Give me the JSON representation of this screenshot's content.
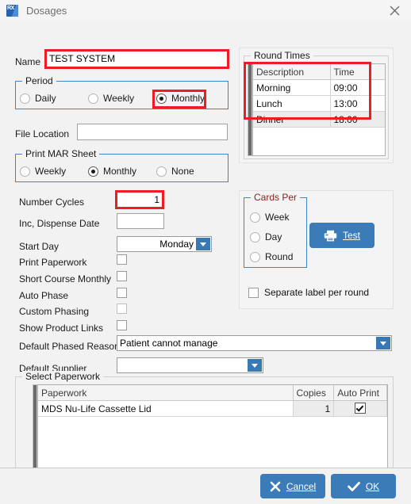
{
  "window": {
    "title": "Dosages",
    "icon": "rx-app-icon",
    "close_label": "close-icon"
  },
  "form": {
    "name_label": "Name",
    "name_value": "TEST SYSTEM",
    "file_location_label": "File Location",
    "file_location_value": "",
    "number_cycles_label": "Number Cycles",
    "number_cycles_value": "1",
    "inc_dispense_date_label": "Inc, Dispense Date",
    "inc_dispense_date_value": "",
    "start_day_label": "Start Day",
    "start_day_value": "Monday",
    "default_phased_reason_label": "Default Phased Reason",
    "default_phased_reason_value": "Patient cannot manage",
    "default_supplier_label": "Default Supplier",
    "default_supplier_value": ""
  },
  "period": {
    "caption": "Period",
    "options": [
      {
        "label": "Daily",
        "selected": false
      },
      {
        "label": "Weekly",
        "selected": false
      },
      {
        "label": "Monthly",
        "selected": true
      }
    ]
  },
  "print_mar_sheet": {
    "caption": "Print MAR Sheet",
    "options": [
      {
        "label": "Weekly",
        "selected": false
      },
      {
        "label": "Monthly",
        "selected": true
      },
      {
        "label": "None",
        "selected": false
      }
    ]
  },
  "checkboxes": [
    {
      "label": "Print Paperwork",
      "checked": false,
      "dim": false
    },
    {
      "label": "Short Course Monthly",
      "checked": false,
      "dim": false
    },
    {
      "label": "Auto Phase",
      "checked": false,
      "dim": false
    },
    {
      "label": "Custom Phasing",
      "checked": false,
      "dim": true
    },
    {
      "label": "Show Product Links",
      "checked": false,
      "dim": false
    }
  ],
  "round_times": {
    "caption": "Round Times",
    "columns": [
      "Description",
      "Time"
    ],
    "rows": [
      {
        "description": "Morning",
        "time": "09:00",
        "selected": false
      },
      {
        "description": "Lunch",
        "time": "13:00",
        "selected": false
      },
      {
        "description": "Dinner",
        "time": "18:00",
        "selected": true
      }
    ]
  },
  "cards_per": {
    "caption": "Cards Per",
    "caption_color": "#8b2020",
    "options": [
      {
        "label": "Week",
        "selected": false
      },
      {
        "label": "Day",
        "selected": false
      },
      {
        "label": "Round",
        "selected": false
      }
    ],
    "test_button": "Test",
    "test_icon": "printer-icon",
    "separate_label_per_round": "Separate label per round",
    "separate_label_checked": false
  },
  "select_paperwork": {
    "caption": "Select Paperwork",
    "columns": [
      "Paperwork",
      "Copies",
      "Auto Print"
    ],
    "rows": [
      {
        "paperwork": "MDS Nu-Life Cassette Lid",
        "copies": "1",
        "auto_print": true
      }
    ]
  },
  "footer": {
    "cancel_label": "Cancel",
    "cancel_icon": "x-icon",
    "ok_label": "OK",
    "ok_icon": "check-icon"
  },
  "highlights": {
    "accent": "#ee1c25",
    "items": [
      "name-field",
      "period-monthly",
      "round-times-table",
      "number-cycles-field"
    ]
  }
}
